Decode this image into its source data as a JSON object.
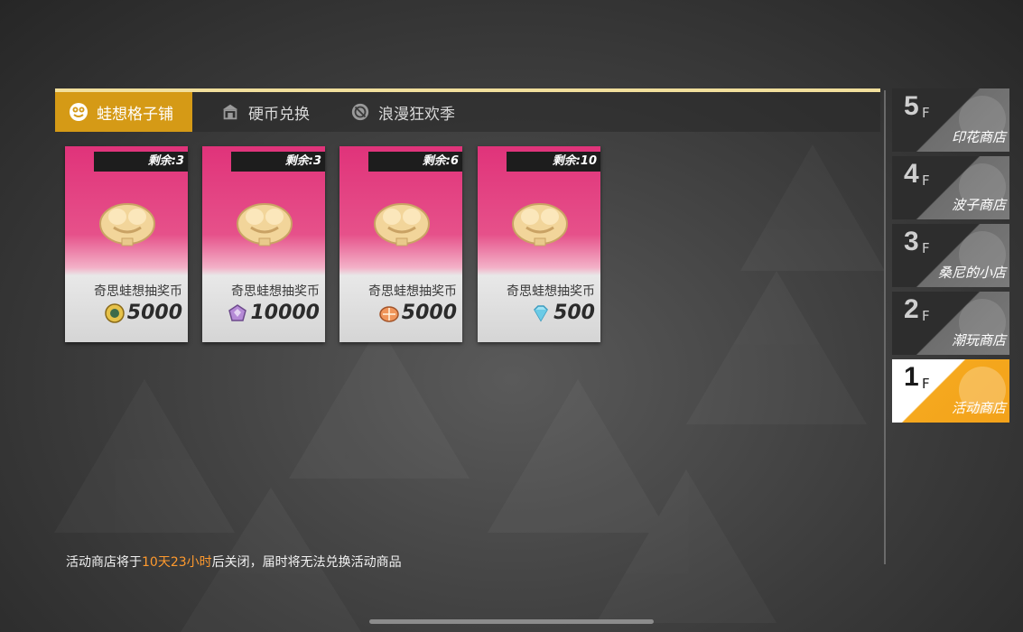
{
  "tabs": [
    {
      "label": "蛙想格子铺",
      "icon": "frog-icon",
      "active": true
    },
    {
      "label": "硬币兑换",
      "icon": "shop-icon",
      "active": false
    },
    {
      "label": "浪漫狂欢季",
      "icon": "badge-icon",
      "active": false
    }
  ],
  "cards": [
    {
      "remain": "剩余:3",
      "name": "奇思蛙想抽奖币",
      "price": "5000",
      "currency_icon": "gold-coin-icon"
    },
    {
      "remain": "剩余:3",
      "name": "奇思蛙想抽奖币",
      "price": "10000",
      "currency_icon": "purple-gem-icon"
    },
    {
      "remain": "剩余:6",
      "name": "奇思蛙想抽奖币",
      "price": "5000",
      "currency_icon": "orange-shell-icon"
    },
    {
      "remain": "剩余:10",
      "name": "奇思蛙想抽奖币",
      "price": "500",
      "currency_icon": "diamond-icon"
    }
  ],
  "notice": {
    "prefix": "活动商店将于",
    "time": "10天23小时",
    "suffix": "后关闭，届时将无法兑换活动商品"
  },
  "floors": [
    {
      "num": "5",
      "f": "F",
      "name": "印花商店",
      "active": false
    },
    {
      "num": "4",
      "f": "F",
      "name": "波子商店",
      "active": false
    },
    {
      "num": "3",
      "f": "F",
      "name": "桑尼的小店",
      "active": false
    },
    {
      "num": "2",
      "f": "F",
      "name": "潮玩商店",
      "active": false
    },
    {
      "num": "1",
      "f": "F",
      "name": "活动商店",
      "active": true
    }
  ],
  "colors": {
    "accent_gold": "#d59a16",
    "card_pink": "#e0337a",
    "highlight_orange": "#ff9a2e",
    "active_floor": "#f5a81e"
  }
}
